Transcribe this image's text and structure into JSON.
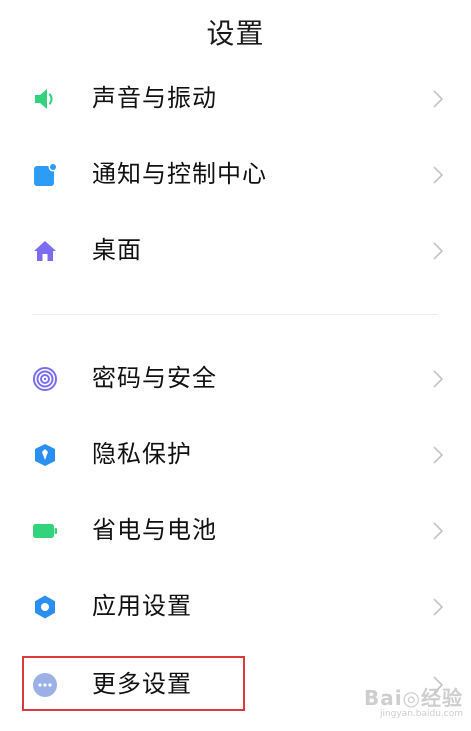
{
  "header": {
    "title": "设置"
  },
  "items": [
    {
      "label": "声音与振动",
      "icon": "speaker-icon",
      "color": "#34d27c"
    },
    {
      "label": "通知与控制中心",
      "icon": "notification-icon",
      "color": "#2c9cf4"
    },
    {
      "label": "桌面",
      "icon": "home-icon",
      "color": "#7c6cf0"
    },
    {
      "label": "密码与安全",
      "icon": "fingerprint-icon",
      "color": "#7b6ef0"
    },
    {
      "label": "隐私保护",
      "icon": "privacy-shield-icon",
      "color": "#2b8ff2"
    },
    {
      "label": "省电与电池",
      "icon": "battery-icon",
      "color": "#33d27c"
    },
    {
      "label": "应用设置",
      "icon": "gear-icon",
      "color": "#2b8ff2"
    },
    {
      "label": "更多设置",
      "icon": "more-icon",
      "color": "#9bb0e6"
    }
  ],
  "watermark": {
    "main": "Bai◎经验",
    "sub": "jingyan.baidu.com"
  }
}
